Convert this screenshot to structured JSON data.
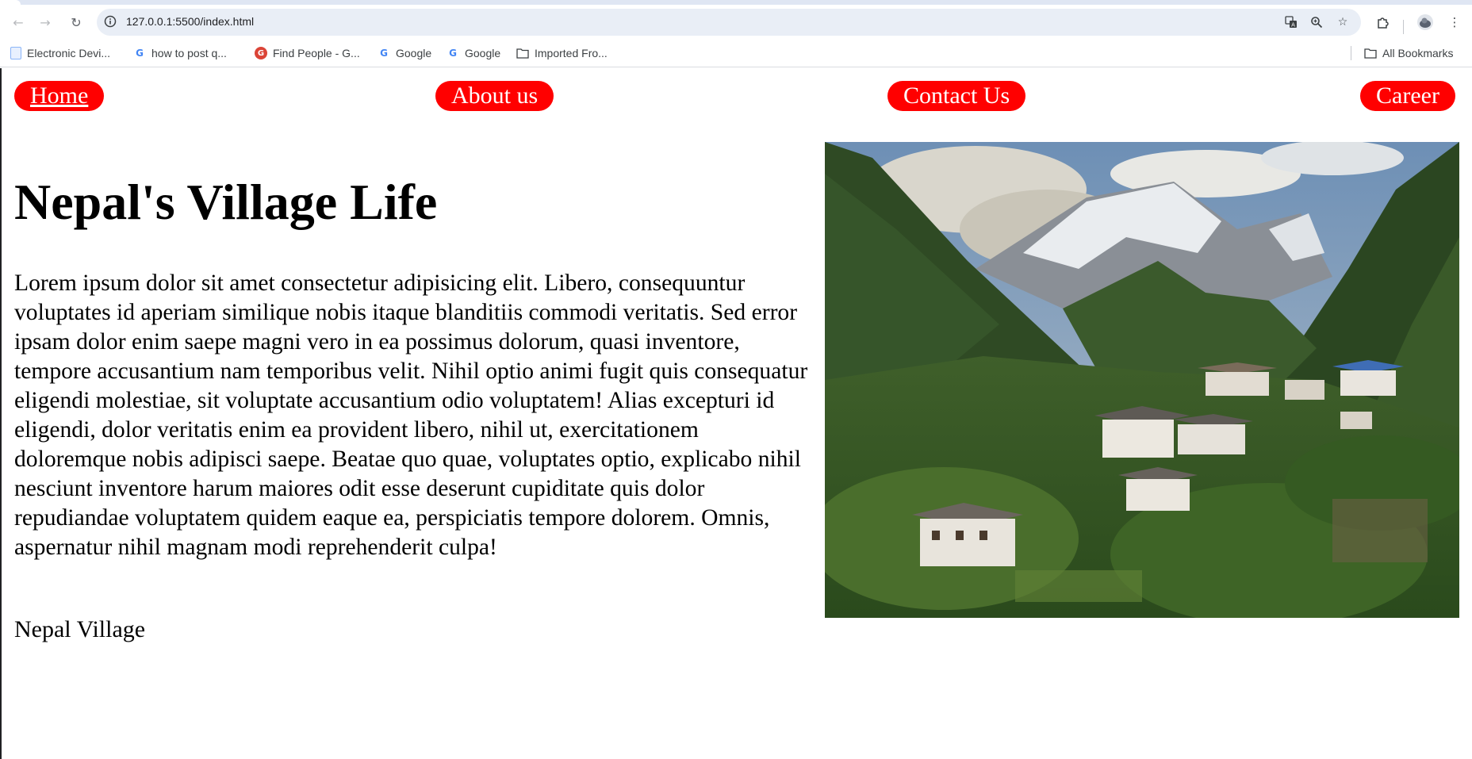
{
  "browser": {
    "url": "127.0.0.1:5500/index.html",
    "bookmarks": [
      {
        "label": "Electronic Devi...",
        "icon": "document-icon"
      },
      {
        "label": "how to post q...",
        "icon": "google-icon"
      },
      {
        "label": "Find People - G...",
        "icon": "google-plus-icon"
      },
      {
        "label": "Google",
        "icon": "google-icon"
      },
      {
        "label": "Google",
        "icon": "google-icon"
      },
      {
        "label": "Imported Fro...",
        "icon": "folder-icon"
      }
    ],
    "all_bookmarks": "All Bookmarks"
  },
  "nav": {
    "home": "Home",
    "about": "About us",
    "contact": "Contact Us",
    "career": "Career"
  },
  "colors": {
    "nav_background": "#ff0000",
    "nav_text": "#ffffff",
    "omnibox": "#e9eef6"
  },
  "main": {
    "title": "Nepal's Village Life",
    "paragraph": "Lorem ipsum dolor sit amet consectetur adipisicing elit. Libero, consequuntur voluptates id aperiam similique nobis itaque blanditiis commodi veritatis. Sed error ipsam dolor enim saepe magni vero in ea possimus dolorum, quasi inventore, tempore accusantium nam temporibus velit. Nihil optio animi fugit quis consequatur eligendi molestiae, sit voluptate accusantium odio voluptatem! Alias excepturi id eligendi, dolor veritatis enim ea provident libero, nihil ut, exercitationem doloremque nobis adipisci saepe. Beatae quo quae, voluptates optio, explicabo nihil nesciunt inventore harum maiores odit esse deserunt cupiditate quis dolor repudiandae voluptatem quidem eaque ea, perspiciatis tempore dolorem. Omnis, aspernatur nihil magnam modi reprehenderit culpa!",
    "caption": "Nepal Village"
  }
}
